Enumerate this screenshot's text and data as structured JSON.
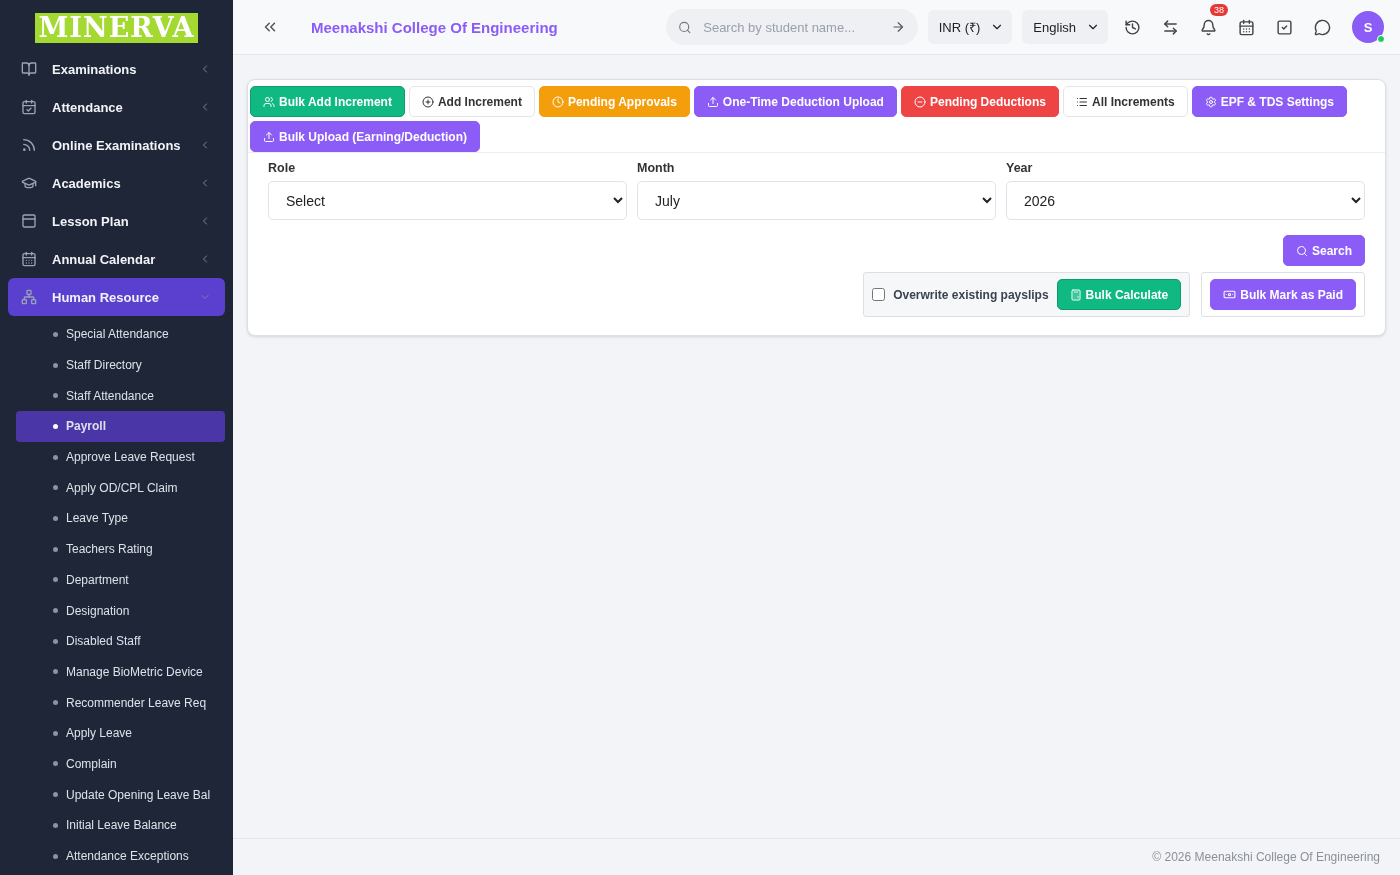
{
  "sidebar": {
    "logo": "MINERVA",
    "items": [
      {
        "label": "Examinations",
        "expanded": false,
        "selected": false
      },
      {
        "label": "Attendance",
        "expanded": false,
        "selected": false
      },
      {
        "label": "Online Examinations",
        "expanded": false,
        "selected": false
      },
      {
        "label": "Academics",
        "expanded": false,
        "selected": false
      },
      {
        "label": "Lesson Plan",
        "expanded": false,
        "selected": false
      },
      {
        "label": "Annual Calendar",
        "expanded": false,
        "selected": false
      },
      {
        "label": "Human Resource",
        "expanded": true,
        "selected": true,
        "children": [
          {
            "label": "Special Attendance",
            "selected": false
          },
          {
            "label": "Staff Directory",
            "selected": false
          },
          {
            "label": "Staff Attendance",
            "selected": false
          },
          {
            "label": "Payroll",
            "selected": true
          },
          {
            "label": "Approve Leave Request",
            "selected": false
          },
          {
            "label": "Apply OD/CPL Claim",
            "selected": false
          },
          {
            "label": "Leave Type",
            "selected": false
          },
          {
            "label": "Teachers Rating",
            "selected": false
          },
          {
            "label": "Department",
            "selected": false
          },
          {
            "label": "Designation",
            "selected": false
          },
          {
            "label": "Disabled Staff",
            "selected": false
          },
          {
            "label": "Manage BioMetric Device",
            "selected": false
          },
          {
            "label": "Recommender Leave Req",
            "selected": false
          },
          {
            "label": "Apply Leave",
            "selected": false
          },
          {
            "label": "Complain",
            "selected": false
          },
          {
            "label": "Update Opening Leave Bal",
            "selected": false
          },
          {
            "label": "Initial Leave Balance",
            "selected": false
          },
          {
            "label": "Attendance Exceptions",
            "selected": false
          }
        ]
      }
    ]
  },
  "topbar": {
    "title": "Meenakshi College Of Engineering",
    "search": {
      "placeholder": "Search by student name..."
    },
    "currency": "INR (₹)",
    "language": "English",
    "notifications": "38",
    "avatar": "S",
    "online": true
  },
  "actions": [
    "Bulk Add Increment",
    "Add Increment",
    "Pending Approvals",
    "One-Time Deduction Upload",
    "Pending Deductions",
    "All Increments",
    "EPF & TDS Settings",
    "Bulk Upload (Earning/Deduction)"
  ],
  "filters": [
    {
      "label": "Role",
      "value": "Select"
    },
    {
      "label": "Month",
      "value": "July"
    },
    {
      "label": "Year",
      "value": "2026"
    }
  ],
  "search_button": "Search",
  "overwrite": {
    "label": "Overwrite existing payslips",
    "checked": false
  },
  "bulk_calculate": "Bulk Calculate",
  "bulk_mark_paid": "Bulk Mark as Paid",
  "footer": "© 2026 Meenakshi College Of Engineering"
}
